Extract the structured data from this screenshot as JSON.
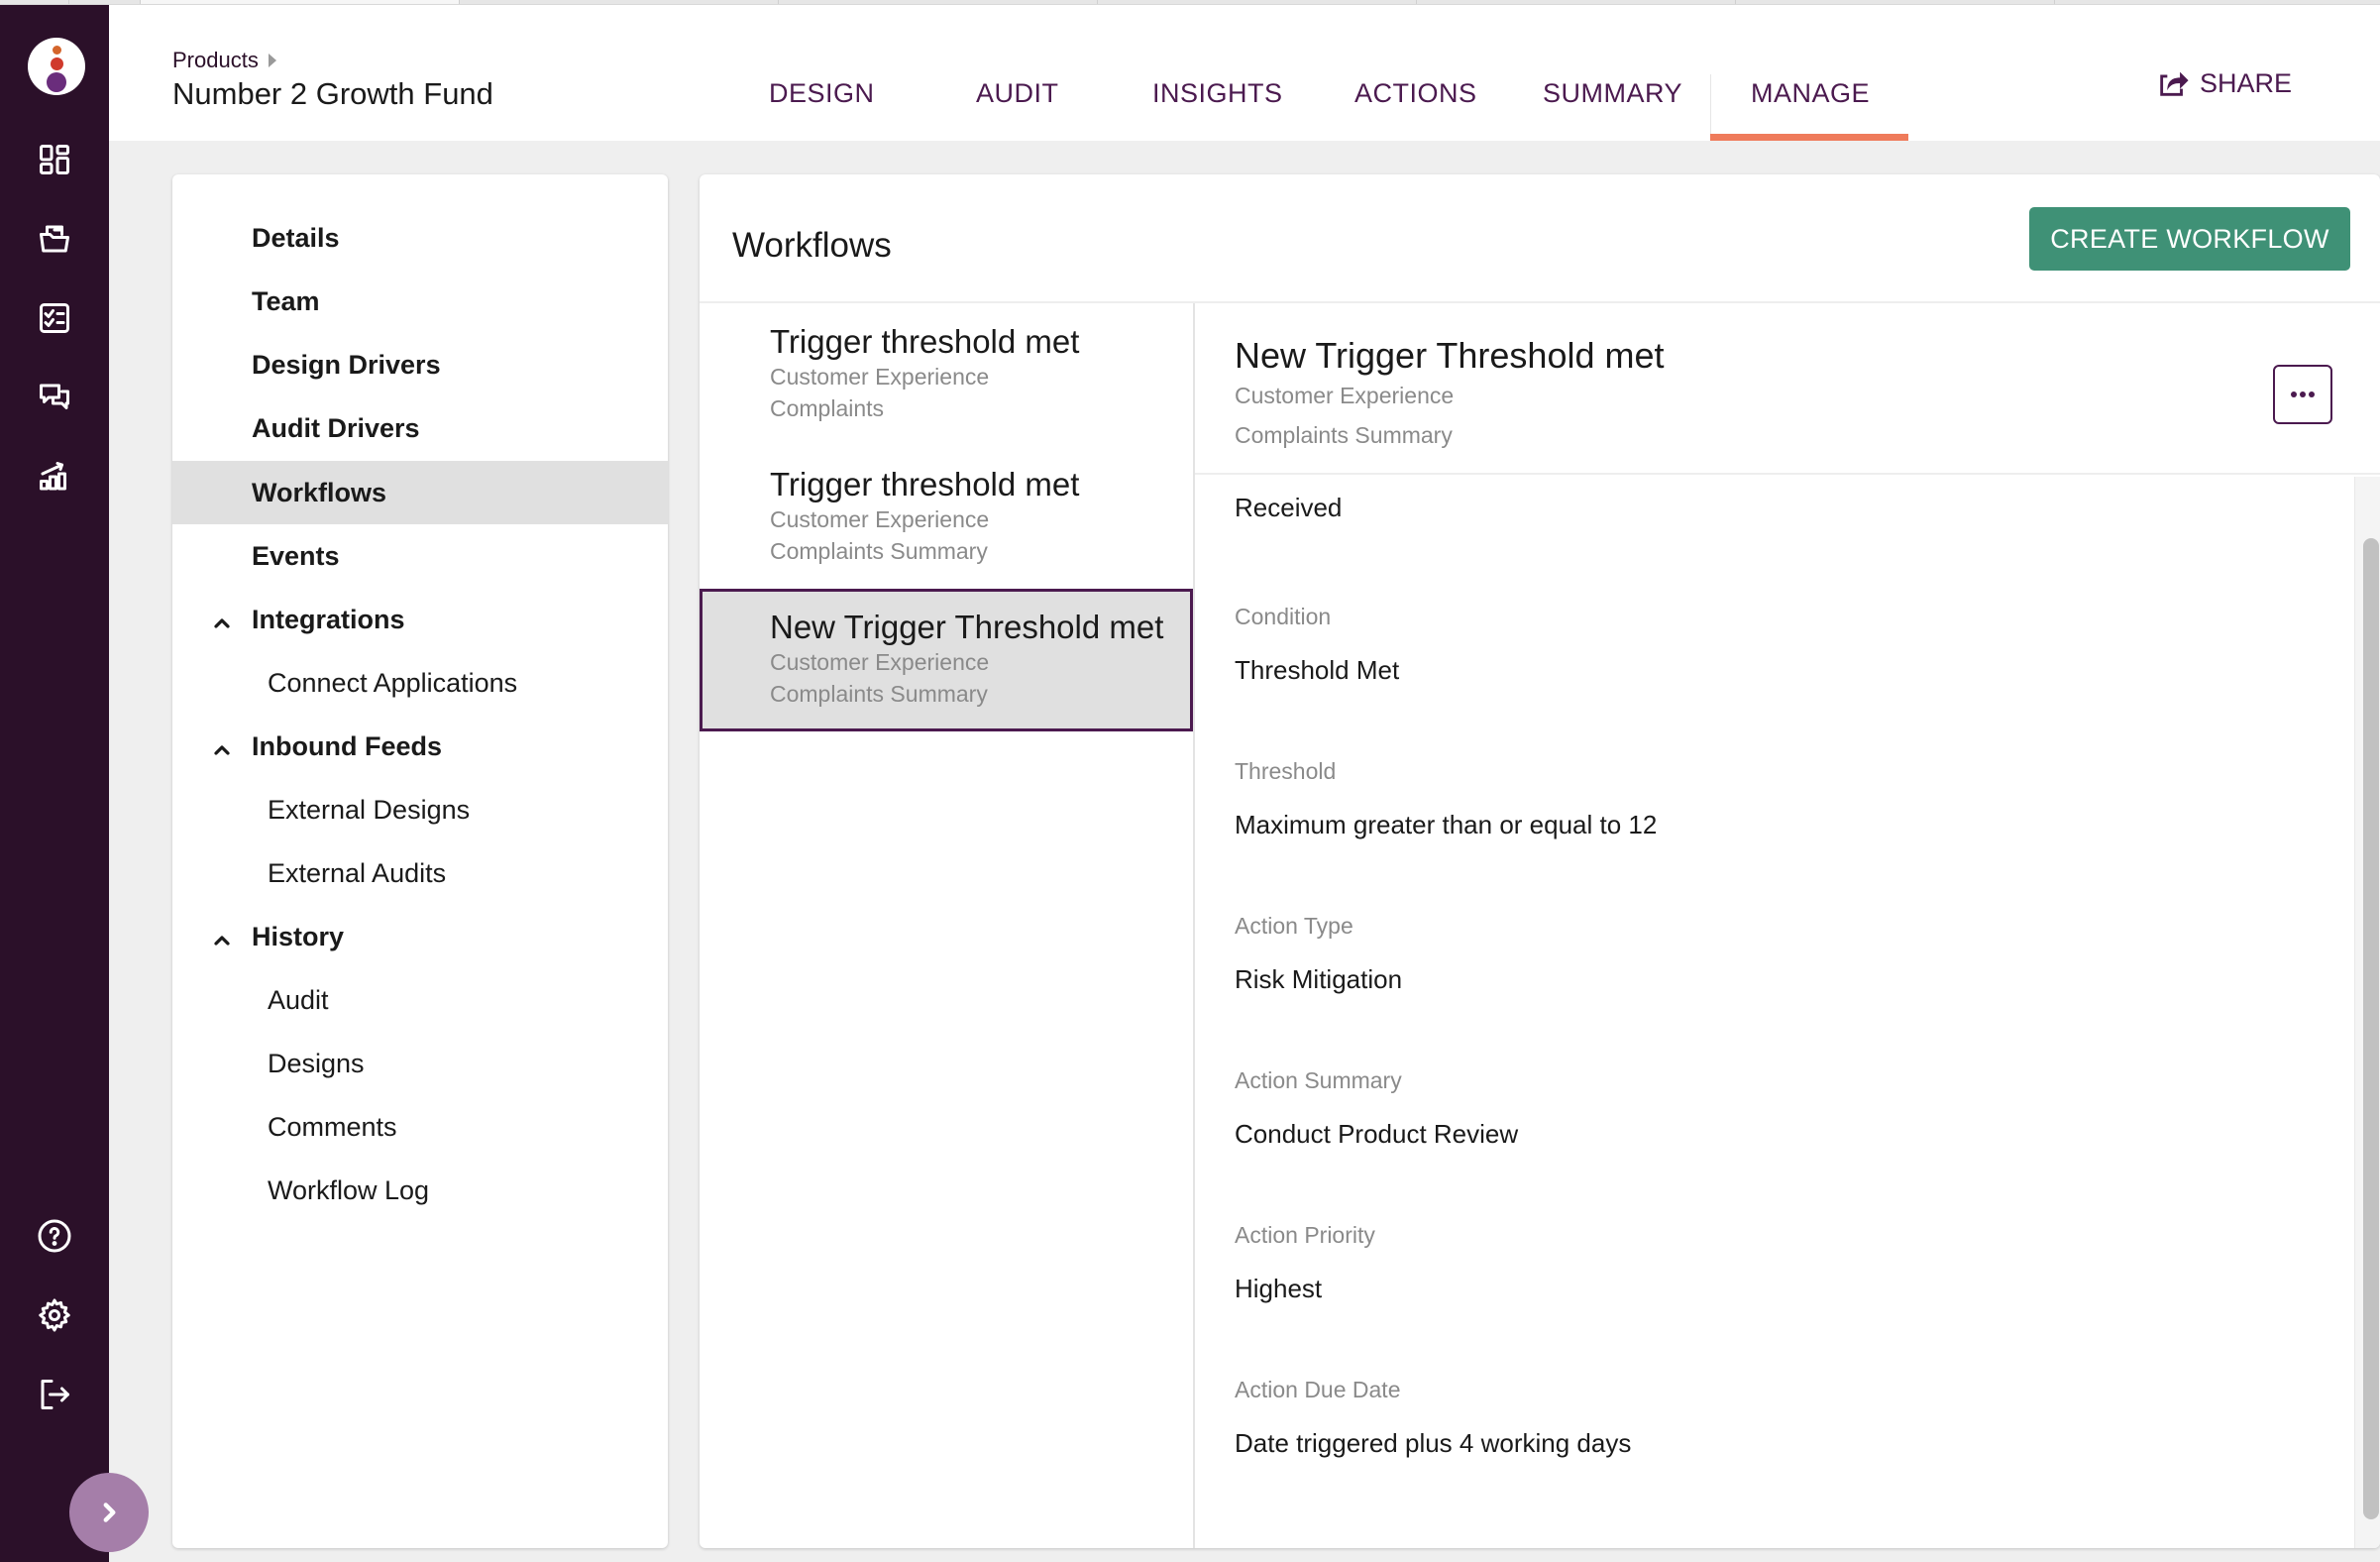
{
  "colors": {
    "rail_bg": "#2b1029",
    "brand_purple": "#4b1a4f",
    "accent_orange": "#ef7b5b",
    "create_button": "#3f9176",
    "selected_bg": "#e0e0e0",
    "expand_button": "#a57ea9"
  },
  "rail": {
    "logo": "brand-logo",
    "top_icons": [
      "dashboard-icon",
      "folder-icon",
      "checklist-icon",
      "comments-icon",
      "analytics-icon"
    ],
    "bottom_icons": [
      "help-icon",
      "settings-icon",
      "logout-icon"
    ],
    "expand": "chevron-right-icon"
  },
  "header": {
    "breadcrumb": "Products",
    "title": "Number 2 Growth Fund",
    "tabs": [
      {
        "label": "DESIGN"
      },
      {
        "label": "AUDIT"
      },
      {
        "label": "INSIGHTS"
      },
      {
        "label": "ACTIONS"
      },
      {
        "label": "SUMMARY"
      },
      {
        "label": "MANAGE",
        "active": true
      }
    ],
    "share_label": "SHARE"
  },
  "nav": {
    "items": [
      {
        "label": "Details",
        "level": "top"
      },
      {
        "label": "Team",
        "level": "top"
      },
      {
        "label": "Design Drivers",
        "level": "top"
      },
      {
        "label": "Audit Drivers",
        "level": "top"
      },
      {
        "label": "Workflows",
        "level": "top",
        "selected": true
      },
      {
        "label": "Events",
        "level": "top"
      },
      {
        "label": "Integrations",
        "level": "group",
        "expanded": true
      },
      {
        "label": "Connect Applications",
        "level": "sub"
      },
      {
        "label": "Inbound Feeds",
        "level": "group",
        "expanded": true
      },
      {
        "label": "External Designs",
        "level": "sub"
      },
      {
        "label": "External Audits",
        "level": "sub"
      },
      {
        "label": "History",
        "level": "group",
        "expanded": true
      },
      {
        "label": "Audit",
        "level": "sub"
      },
      {
        "label": "Designs",
        "level": "sub"
      },
      {
        "label": "Comments",
        "level": "sub"
      },
      {
        "label": "Workflow Log",
        "level": "sub"
      }
    ]
  },
  "workflows": {
    "title": "Workflows",
    "create_label": "CREATE WORKFLOW",
    "list": [
      {
        "name": "Trigger threshold met",
        "category": "Customer Experience",
        "source": "Complaints"
      },
      {
        "name": "Trigger threshold met",
        "category": "Customer Experience",
        "source": "Complaints Summary"
      },
      {
        "name": "New Trigger Threshold met",
        "category": "Customer Experience",
        "source": "Complaints Summary",
        "selected": true
      }
    ],
    "detail": {
      "name": "New Trigger Threshold met",
      "category": "Customer Experience",
      "source": "Complaints Summary",
      "more_icon": "more-horizontal-icon",
      "first_value": "Received",
      "fields": [
        {
          "label": "Condition",
          "value": "Threshold Met"
        },
        {
          "label": "Threshold",
          "value": "Maximum greater than or equal to 12"
        },
        {
          "label": "Action Type",
          "value": "Risk Mitigation"
        },
        {
          "label": "Action Summary",
          "value": "Conduct Product Review"
        },
        {
          "label": "Action Priority",
          "value": "Highest"
        },
        {
          "label": "Action Due Date",
          "value": "Date triggered plus 4 working days"
        }
      ]
    }
  }
}
